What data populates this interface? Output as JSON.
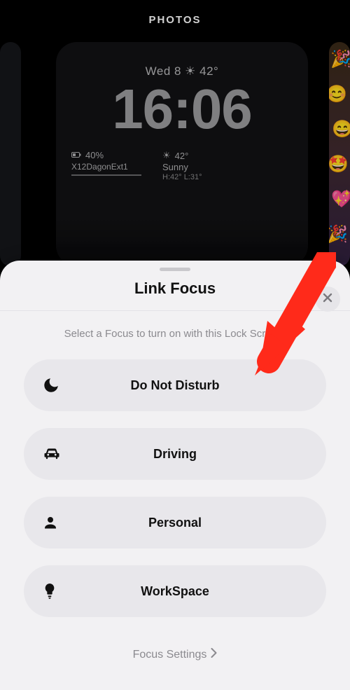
{
  "header": {
    "title": "PHOTOS"
  },
  "lockscreen": {
    "date_line": "Wed 8  ☀  42°",
    "time": "16:06",
    "battery_pct": "40%",
    "network_label": "X12DagonExt1",
    "weather_temp": "42°",
    "weather_cond": "Sunny",
    "weather_hilo": "H:42° L:31°"
  },
  "sheet": {
    "title": "Link Focus",
    "subtitle": "Select a Focus to turn on with this Lock Screen.",
    "close_aria": "Close",
    "items": [
      {
        "icon": "moon",
        "label": "Do Not Disturb"
      },
      {
        "icon": "car",
        "label": "Driving"
      },
      {
        "icon": "person",
        "label": "Personal"
      },
      {
        "icon": "bulb",
        "label": "WorkSpace"
      }
    ],
    "footer": "Focus Settings"
  }
}
